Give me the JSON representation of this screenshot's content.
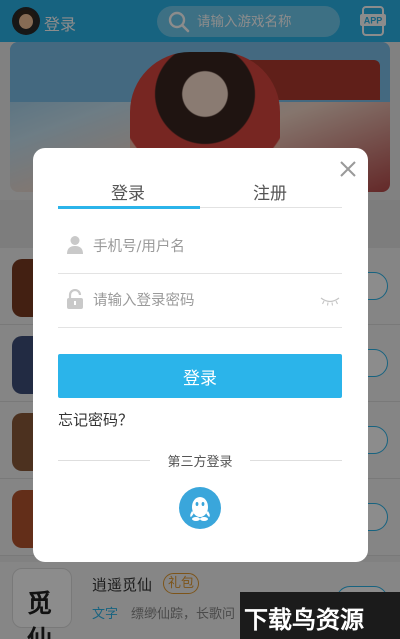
{
  "header": {
    "login_label": "登录",
    "search_placeholder": "请输入游戏名称",
    "app_label": "APP"
  },
  "game": {
    "thumb_text": "觅仙",
    "name": "逍遥觅仙",
    "tag": "礼包",
    "type": "文字",
    "desc": "缥缈仙踪，长歌问"
  },
  "modal": {
    "tabs": [
      {
        "label": "登录",
        "active": true
      },
      {
        "label": "注册",
        "active": false
      }
    ],
    "username_placeholder": "手机号/用户名",
    "password_placeholder": "请输入登录密码",
    "submit_label": "登录",
    "forgot_label": "忘记密码？",
    "third_party_label": "第三方登录"
  },
  "watermark": "下载鸟资源",
  "colors": {
    "accent": "#2bb4ea",
    "tag": "#e39a2e",
    "qq": "#3aa6db"
  }
}
